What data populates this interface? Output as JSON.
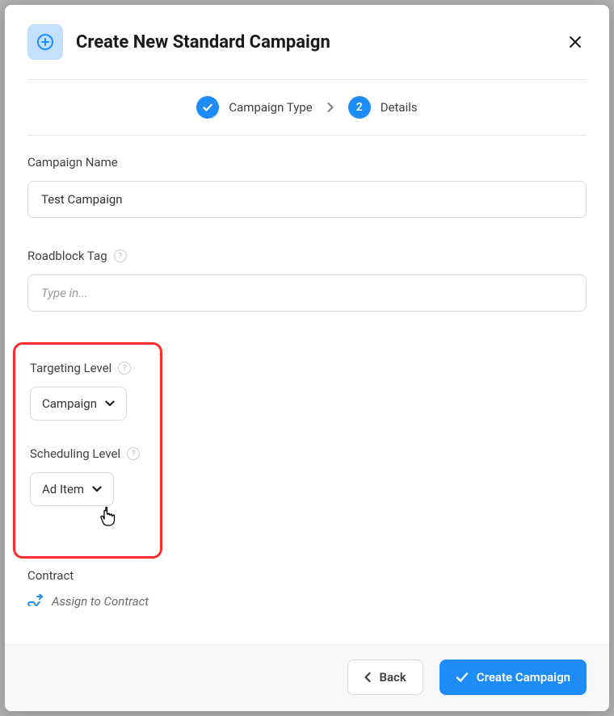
{
  "header": {
    "title": "Create New Standard Campaign"
  },
  "stepper": {
    "steps": [
      {
        "label": "Campaign Type",
        "state": "done"
      },
      {
        "number": "2",
        "label": "Details",
        "state": "current"
      }
    ]
  },
  "fields": {
    "campaign_name": {
      "label": "Campaign Name",
      "value": "Test Campaign"
    },
    "roadblock_tag": {
      "label": "Roadblock Tag",
      "placeholder": "Type in...",
      "value": ""
    },
    "targeting_level": {
      "label": "Targeting Level",
      "value": "Campaign"
    },
    "scheduling_level": {
      "label": "Scheduling Level",
      "value": "Ad Item"
    },
    "contract": {
      "label": "Contract",
      "link_text": "Assign to Contract"
    }
  },
  "footer": {
    "back": "Back",
    "create": "Create Campaign"
  },
  "colors": {
    "accent": "#1e8cf8",
    "highlight_border": "#ff2d2d"
  }
}
